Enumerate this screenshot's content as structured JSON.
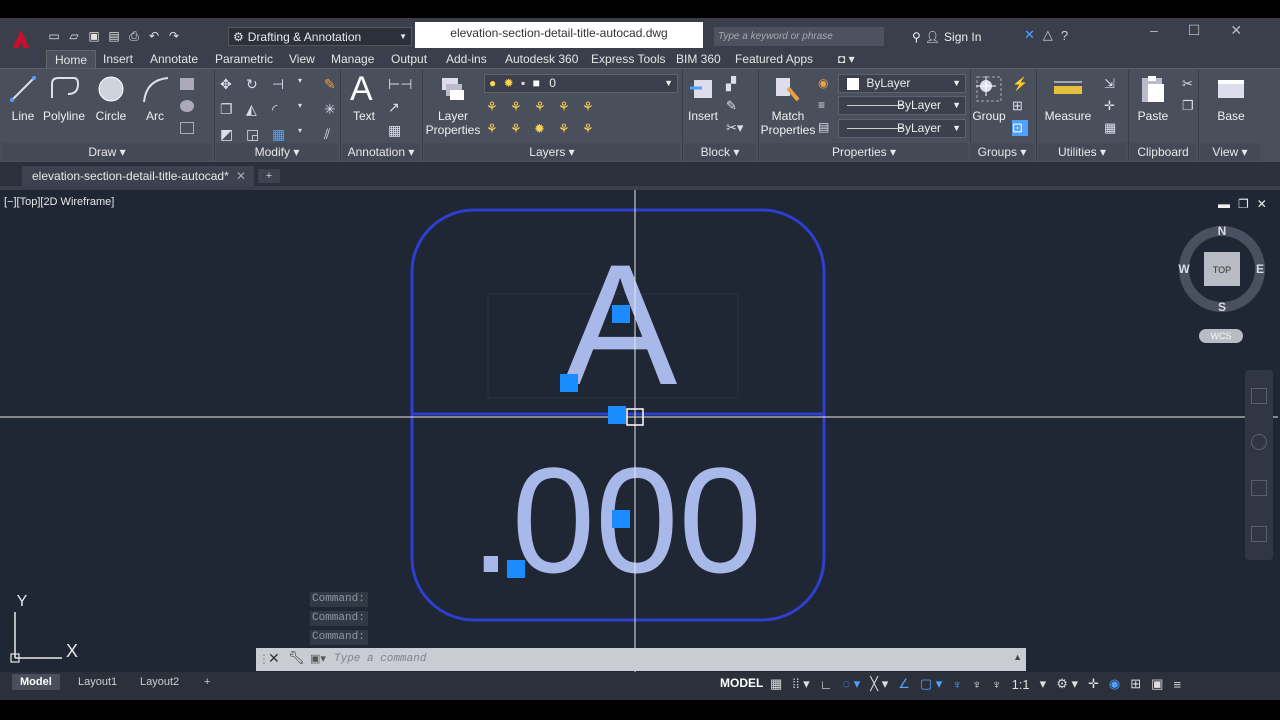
{
  "window": {
    "title": "elevation-section-detail-title-autocad.dwg",
    "workspace": "Drafting & Annotation",
    "search_placeholder": "Type a keyword or phrase",
    "sign_in": "Sign In"
  },
  "tabs": [
    "Home",
    "Insert",
    "Annotate",
    "Parametric",
    "View",
    "Manage",
    "Output",
    "Add-ins",
    "Autodesk 360",
    "Express Tools",
    "BIM 360",
    "Featured Apps"
  ],
  "ribbon": {
    "draw": {
      "line": "Line",
      "polyline": "Polyline",
      "circle": "Circle",
      "arc": "Arc",
      "panel": "Draw"
    },
    "modify": {
      "panel": "Modify"
    },
    "annotation": {
      "text": "Text",
      "panel": "Annotation"
    },
    "layers": {
      "layer_properties": "Layer Properties",
      "current_layer": "0",
      "panel": "Layers"
    },
    "block": {
      "insert": "Insert",
      "panel": "Block"
    },
    "properties": {
      "match": "Match Properties",
      "color": "ByLayer",
      "linetype": "ByLayer",
      "lineweight": "ByLayer",
      "panel": "Properties"
    },
    "groups": {
      "group": "Group",
      "panel": "Groups"
    },
    "utilities": {
      "measure": "Measure",
      "panel": "Utilities"
    },
    "clipboard": {
      "paste": "Paste",
      "panel": "Clipboard"
    },
    "view": {
      "base": "Base",
      "panel": "View"
    }
  },
  "file_tab": "elevation-section-detail-title-autocad*",
  "viewport": {
    "label": "[−][Top][2D Wireframe]",
    "viewcube": {
      "top": "TOP",
      "n": "N",
      "s": "S",
      "e": "E",
      "w": "W",
      "wcs": "WCS"
    },
    "drawing": {
      "letter": "A",
      "elevation": ".000"
    },
    "ucs": {
      "x": "X",
      "y": "Y"
    }
  },
  "command": {
    "history": [
      "Command:",
      "Command:",
      "Command:"
    ],
    "placeholder": "Type a command"
  },
  "layout_tabs": [
    "Model",
    "Layout1",
    "Layout2"
  ],
  "status": {
    "model": "MODEL",
    "scale": "1:1"
  },
  "colors": {
    "accent_red": "#c8102e",
    "drawing_blue": "#2e3fd0",
    "grip_blue": "#1a8cff",
    "text_light": "#a8b8e8"
  }
}
